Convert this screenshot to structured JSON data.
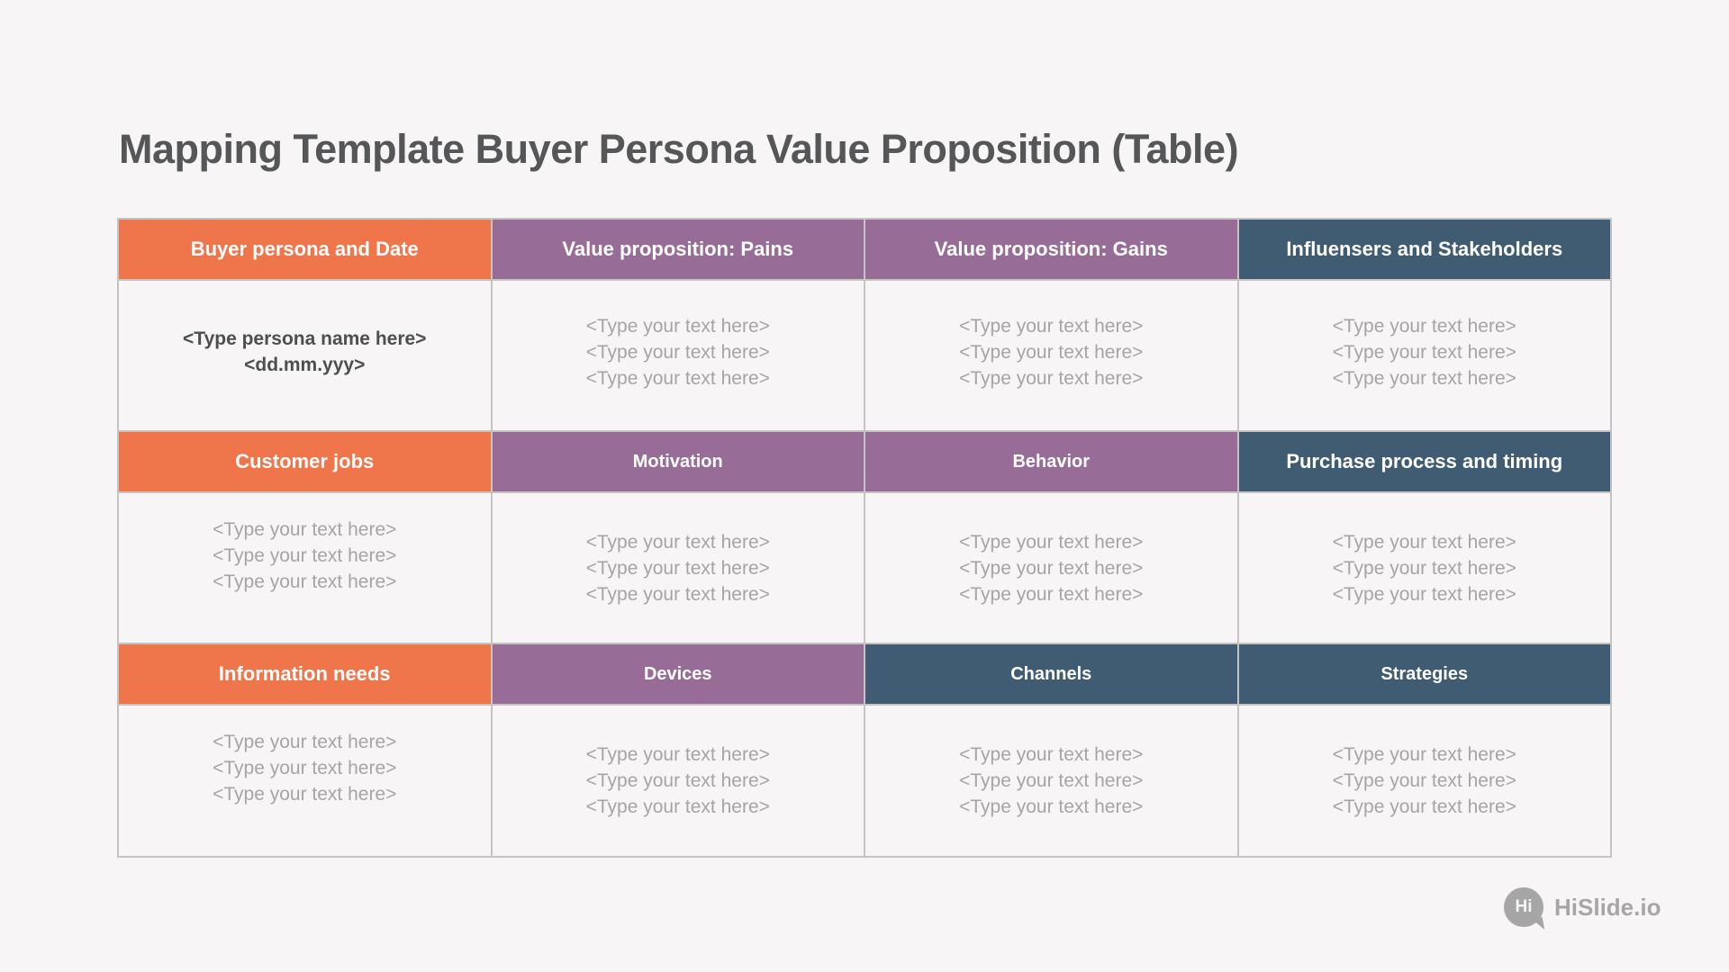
{
  "title": "Mapping Template Buyer Persona Value Proposition (Table)",
  "colors": {
    "orange": "#ef764b",
    "purple": "#976d97",
    "navy": "#3f5c72",
    "background": "#f7f5f6",
    "title_text": "#555657",
    "placeholder_text": "#a6a5a5"
  },
  "table": {
    "rows": [
      {
        "headers": [
          {
            "label": "Buyer persona and Date",
            "color": "orange"
          },
          {
            "label": "Value proposition: Pains",
            "color": "purple"
          },
          {
            "label": "Value proposition: Gains",
            "color": "purple"
          },
          {
            "label": "Influensers and Stakeholders",
            "color": "navy"
          }
        ],
        "cells": [
          {
            "lines": [
              "<Type persona name here>",
              "<dd.mm.yyy>"
            ]
          },
          {
            "lines": [
              "<Type your text here>",
              "<Type your text here>",
              "<Type your text here>"
            ]
          },
          {
            "lines": [
              "<Type your text here>",
              "<Type your text here>",
              "<Type your text here>"
            ]
          },
          {
            "lines": [
              "<Type your text here>",
              "<Type your text here>",
              "<Type your text here>"
            ]
          }
        ]
      },
      {
        "headers": [
          {
            "label": "Customer jobs",
            "color": "orange"
          },
          {
            "label": "Motivation",
            "color": "purple"
          },
          {
            "label": "Behavior",
            "color": "purple"
          },
          {
            "label": "Purchase process and timing",
            "color": "navy"
          }
        ],
        "cells": [
          {
            "lines": [
              "<Type your text here>",
              "<Type your text here>",
              "<Type your text here>"
            ]
          },
          {
            "lines": [
              "<Type your text here>",
              "<Type your text here>",
              "<Type your text here>"
            ]
          },
          {
            "lines": [
              "<Type your text here>",
              "<Type your text here>",
              "<Type your text here>"
            ]
          },
          {
            "lines": [
              "<Type your text here>",
              "<Type your text here>",
              "<Type your text here>"
            ]
          }
        ]
      },
      {
        "headers": [
          {
            "label": "Information needs",
            "color": "orange"
          },
          {
            "label": "Devices",
            "color": "purple"
          },
          {
            "label": "Channels",
            "color": "navy"
          },
          {
            "label": "Strategies",
            "color": "navy"
          }
        ],
        "cells": [
          {
            "lines": [
              "<Type your text here>",
              "<Type your text here>",
              "<Type your text here>"
            ]
          },
          {
            "lines": [
              "<Type your text here>",
              "<Type your text here>",
              "<Type your text here>"
            ]
          },
          {
            "lines": [
              "<Type your text here>",
              "<Type your text here>",
              "<Type your text here>"
            ]
          },
          {
            "lines": [
              "<Type your text here>",
              "<Type your text here>",
              "<Type your text here>"
            ]
          }
        ]
      }
    ]
  },
  "brand": {
    "logo_text": "Hi",
    "name": "HiSlide.io",
    "logo_icon": "speech-bubble-icon"
  }
}
